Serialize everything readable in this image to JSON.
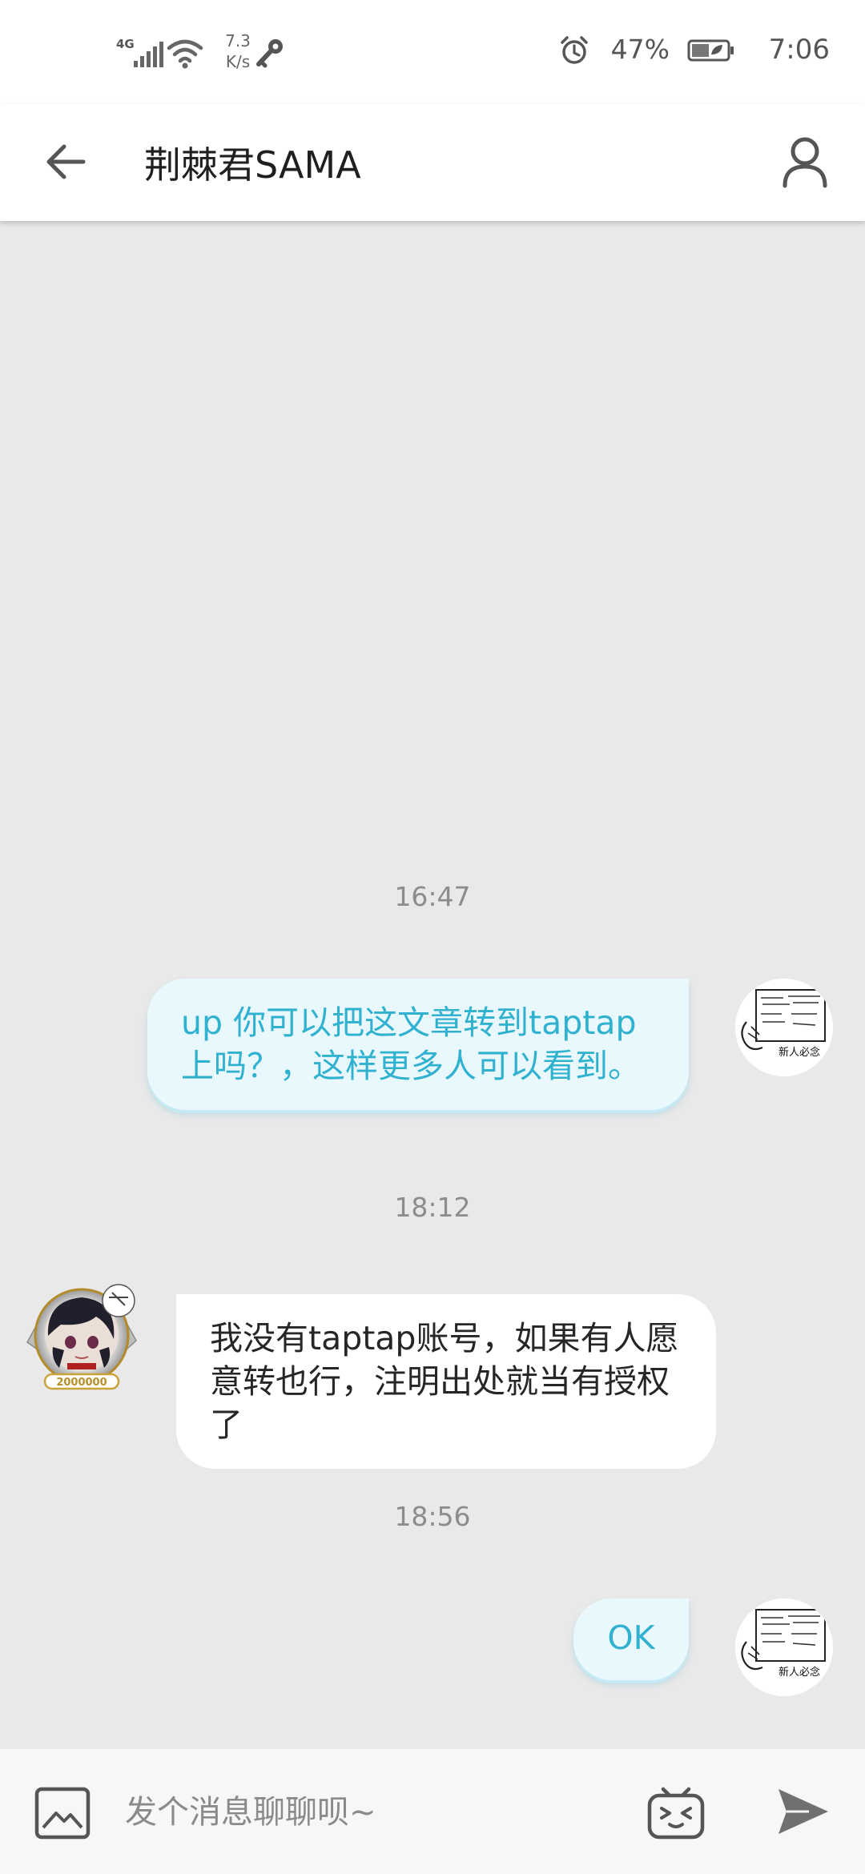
{
  "status_bar": {
    "network_type": "4G",
    "net_speed_value": "7.3",
    "net_speed_unit": "K/s",
    "battery_percent": "47%",
    "time": "7:06"
  },
  "app_bar": {
    "title": "荆棘君SAMA"
  },
  "messages": [
    {
      "type": "timestamp",
      "text": "16:47"
    },
    {
      "type": "outgoing",
      "text": "up 你可以把这文章转到taptap上吗？，这样更多人可以看到。"
    },
    {
      "type": "timestamp",
      "text": "18:12"
    },
    {
      "type": "incoming",
      "text": "我没有taptap账号，如果有人愿意转也行，注明出处就当有授权了"
    },
    {
      "type": "timestamp",
      "text": "18:56"
    },
    {
      "type": "outgoing",
      "text": "OK"
    }
  ],
  "avatars": {
    "self_caption": "新人必念",
    "contact_badge": "2000000"
  },
  "input_bar": {
    "placeholder": "发个消息聊聊呗~"
  },
  "colors": {
    "accent": "#2fb1cf",
    "outgoing_bubble": "#e9f8fc",
    "background": "#e9e9e9"
  }
}
